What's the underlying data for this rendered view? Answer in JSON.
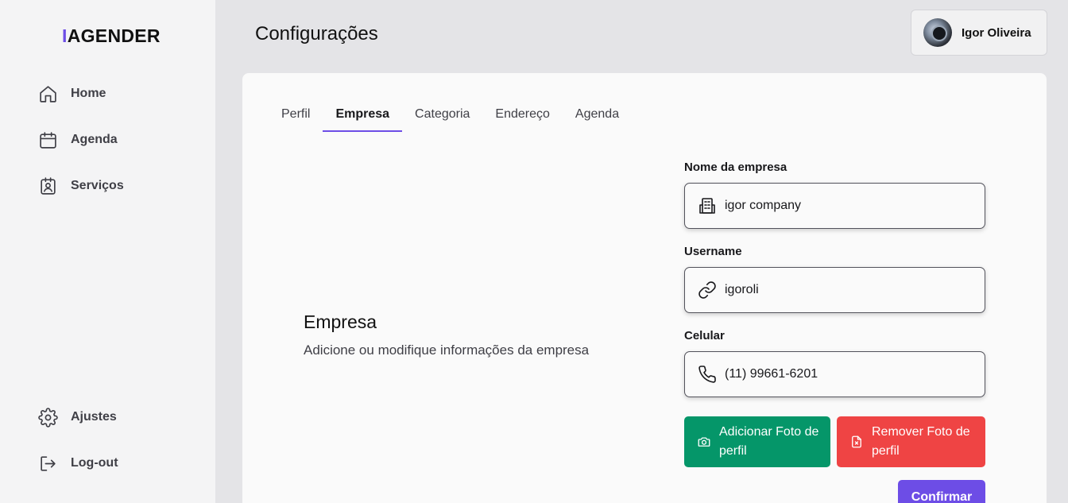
{
  "app": {
    "logo_bar": "I",
    "logo_text": "AGENDER"
  },
  "sidebar": {
    "items": [
      {
        "label": "Home",
        "icon": "home-icon"
      },
      {
        "label": "Agenda",
        "icon": "calendar-icon"
      },
      {
        "label": "Serviços",
        "icon": "clipboard-user-icon"
      }
    ],
    "bottom_items": [
      {
        "label": "Ajustes",
        "icon": "gear-icon"
      },
      {
        "label": "Log-out",
        "icon": "logout-icon"
      }
    ]
  },
  "header": {
    "title": "Configurações",
    "user_name": "Igor Oliveira"
  },
  "tabs": [
    {
      "label": "Perfil",
      "active": false
    },
    {
      "label": "Empresa",
      "active": true
    },
    {
      "label": "Categoria",
      "active": false
    },
    {
      "label": "Endereço",
      "active": false
    },
    {
      "label": "Agenda",
      "active": false
    }
  ],
  "section": {
    "title": "Empresa",
    "description": "Adicione ou modifique informações da empresa"
  },
  "form": {
    "company_name": {
      "label": "Nome da empresa",
      "value": "igor company",
      "icon": "building-icon"
    },
    "username": {
      "label": "Username",
      "value": "igoroli",
      "icon": "link-icon"
    },
    "phone": {
      "label": "Celular",
      "value": "(11) 99661-6201",
      "icon": "phone-icon"
    }
  },
  "buttons": {
    "add_photo": "Adicionar Foto de perfil",
    "remove_photo": "Remover Foto de perfil",
    "confirm": "Confirmar"
  },
  "colors": {
    "accent": "#6d4de6",
    "success": "#059669",
    "danger": "#ef4444"
  }
}
